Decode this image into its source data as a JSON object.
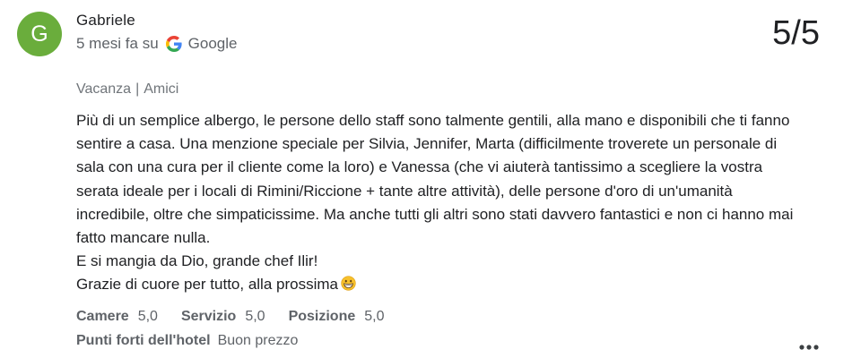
{
  "review": {
    "avatar_letter": "G",
    "author": "Gabriele",
    "time": "5 mesi fa su",
    "source": "Google",
    "score": "5/5",
    "tags": [
      "Vacanza",
      "Amici"
    ],
    "tag_separator": "|",
    "paragraphs": [
      "Più di un semplice albergo, le persone dello staff sono talmente gentili, alla mano e disponibili che ti fanno sentire a casa. Una menzione speciale per Silvia, Jennifer, Marta (difficilmente troverete un personale di sala con una cura per il cliente come la loro) e Vanessa (che vi aiuterà tantissimo a scegliere la vostra serata ideale per i locali di Rimini/Riccione + tante altre attività), delle persone d'oro di un'umanità incredibile, oltre che simpaticissime. Ma anche tutti gli altri sono stati davvero fantastici e non ci hanno mai fatto mancare nulla.",
      "E si mangia da Dio, grande chef Ilir!",
      "Grazie di cuore per tutto, alla prossima"
    ],
    "ratings": [
      {
        "label": "Camere",
        "value": "5,0"
      },
      {
        "label": "Servizio",
        "value": "5,0"
      },
      {
        "label": "Posizione",
        "value": "5,0"
      }
    ],
    "highlights_label": "Punti forti dell'hotel",
    "highlights_value": "Buon prezzo"
  },
  "icons": {
    "source_logo": "google-g-icon",
    "closing_emoji": "grinning-face-emoji-icon",
    "more_options": "more-horiz-icon"
  },
  "colors": {
    "avatar_background": "#6aad3c",
    "text_primary": "#202124",
    "text_secondary": "#5f6368"
  }
}
